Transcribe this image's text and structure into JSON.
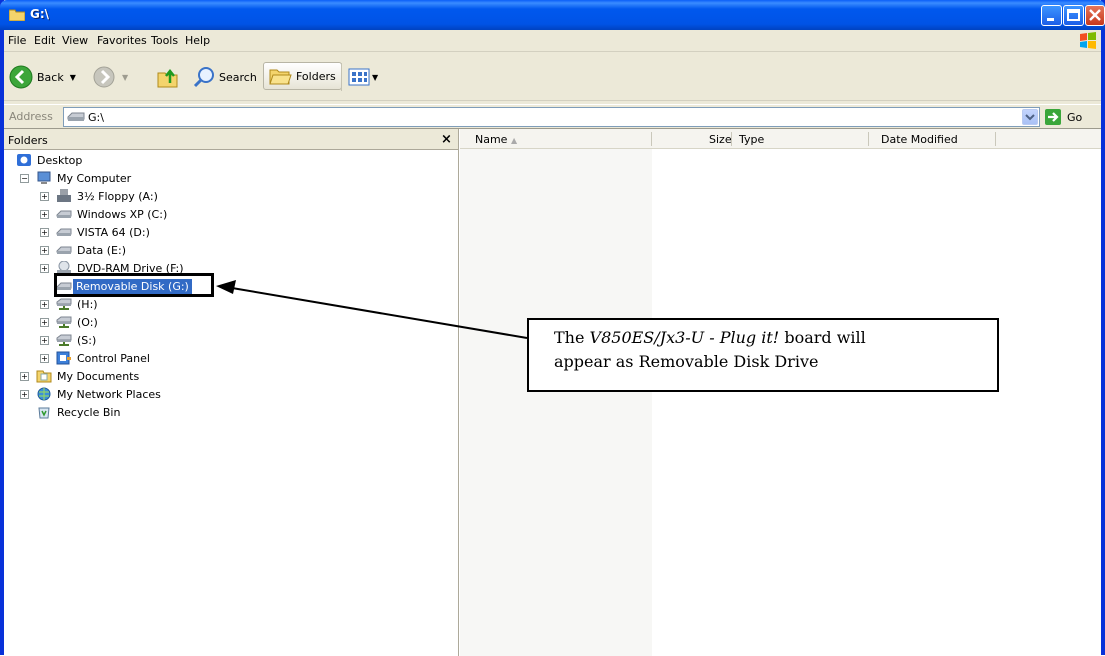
{
  "window": {
    "title": "G:\\"
  },
  "menu": [
    "File",
    "Edit",
    "View",
    "Favorites",
    "Tools",
    "Help"
  ],
  "toolbar": {
    "back": "Back",
    "search": "Search",
    "folders": "Folders"
  },
  "address": {
    "label": "Address",
    "value": "G:\\",
    "go": "Go"
  },
  "folders_pane": {
    "title": "Folders",
    "close": "×",
    "items": [
      {
        "label": "Desktop",
        "icon": "desktop-icon"
      },
      {
        "label": "My Computer",
        "icon": "my-computer-icon"
      },
      {
        "label": "3½ Floppy (A:)",
        "icon": "floppy-icon"
      },
      {
        "label": "Windows XP (C:)",
        "icon": "hard-drive-icon"
      },
      {
        "label": "VISTA 64 (D:)",
        "icon": "hard-drive-icon"
      },
      {
        "label": "Data (E:)",
        "icon": "hard-drive-icon"
      },
      {
        "label": "DVD-RAM Drive (F:)",
        "icon": "dvd-drive-icon"
      },
      {
        "label": "Removable Disk (G:)",
        "icon": "removable-disk-icon"
      },
      {
        "label": "(H:)",
        "icon": "network-drive-icon"
      },
      {
        "label": "(O:)",
        "icon": "network-drive-icon"
      },
      {
        "label": "(S:)",
        "icon": "network-drive-icon"
      },
      {
        "label": "Control Panel",
        "icon": "control-panel-icon"
      },
      {
        "label": "My Documents",
        "icon": "my-documents-icon"
      },
      {
        "label": "My Network Places",
        "icon": "network-places-icon"
      },
      {
        "label": "Recycle Bin",
        "icon": "recycle-bin-icon"
      }
    ]
  },
  "columns": [
    "Name",
    "Size",
    "Type",
    "Date Modified"
  ],
  "callout": {
    "line1_pre": "The ",
    "line1_italic": "V850ES/Jx3-U - Plug it!",
    "line1_post": " board will",
    "line2": "appear as Removable Disk Drive"
  },
  "colors": {
    "title_blue": "#0054e3",
    "selection": "#316ac5"
  }
}
